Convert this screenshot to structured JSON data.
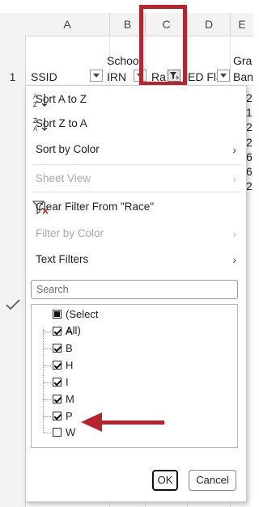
{
  "columns": [
    {
      "letter": "A"
    },
    {
      "letter": "B"
    },
    {
      "letter": "C"
    },
    {
      "letter": "D"
    },
    {
      "letter": "E"
    }
  ],
  "rows": {
    "header_row_number": "1",
    "header_cells": {
      "a": "SSID",
      "b_line1": "Schoo",
      "b_line2": "IRN",
      "c": "Ra",
      "d": "ED Fla",
      "e_line1": "Gra",
      "e_line2": "Ban"
    },
    "right_edge_values": [
      "2",
      "1",
      "2",
      "2",
      "6",
      "6",
      "2"
    ]
  },
  "menu": {
    "sort_az": "Sort A to Z",
    "sort_za": "Sort Z to A",
    "sort_by_color": "Sort by Color",
    "sheet_view": "Sheet View",
    "clear_filter": "Clear Filter From \"Race\"",
    "filter_by_color": "Filter by Color",
    "text_filters": "Text Filters",
    "search_placeholder": "Search",
    "list_items": [
      {
        "label": "(Select All)",
        "state": "indeterminate"
      },
      {
        "label": "A",
        "state": "checked"
      },
      {
        "label": "B",
        "state": "checked"
      },
      {
        "label": "H",
        "state": "checked"
      },
      {
        "label": "I",
        "state": "checked"
      },
      {
        "label": "M",
        "state": "checked"
      },
      {
        "label": "P",
        "state": "checked"
      },
      {
        "label": "W",
        "state": "unchecked"
      }
    ],
    "ok_label": "OK",
    "cancel_label": "Cancel"
  },
  "annotation_color": "#b5252f",
  "icons": {
    "sort_az": "sort-ascending-icon",
    "sort_za": "sort-descending-icon",
    "clear_filter": "clear-filter-icon",
    "chevron": "chevron-right-icon",
    "filter_button": "dropdown-arrow-icon",
    "active_filter": "filter-funnel-icon"
  }
}
